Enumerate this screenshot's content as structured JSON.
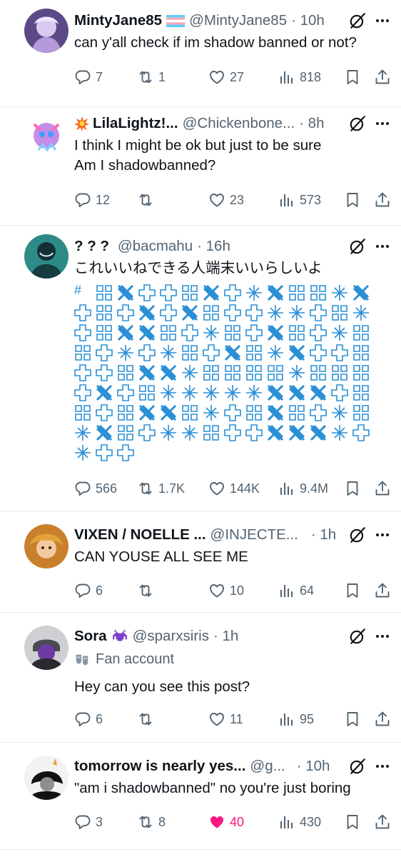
{
  "colors": {
    "text": "#0f1419",
    "muted": "#536471",
    "like": "#f91880",
    "divider": "#e6e9eb",
    "art": "#2a8fd6"
  },
  "posts": [
    {
      "name": "MintyJane85",
      "handle": "@MintyJane85",
      "time": "· 10h",
      "text": "can y'all check if im shadow banned or not?",
      "replies": "7",
      "reposts": "1",
      "likes": "27",
      "views": "818",
      "badge": "trans-flag-icon",
      "liked": false
    },
    {
      "name": "LilaLightz!...",
      "handle": "@Chickenbone...",
      "time": "· 8h",
      "text": "I think I might be ok but just to be sure",
      "text2": "Am I shadowbanned?",
      "replies": "12",
      "reposts": "",
      "likes": "23",
      "views": "573",
      "badge": "explosion-emoji-icon",
      "liked": false
    },
    {
      "name": "? ? ?",
      "handle": "@bacmahu",
      "time": "· 16h",
      "text": "これいいねできる人端末いいらしいよ",
      "art_lead": "#",
      "replies": "566",
      "reposts": "1.7K",
      "likes": "144K",
      "views": "9.4M",
      "liked": false
    },
    {
      "name": "VIXEN / NOELLE ...",
      "handle": "@INJECTE...",
      "time": "· 1h",
      "text": "CAN YOUSE ALL SEE ME",
      "replies": "6",
      "reposts": "",
      "likes": "10",
      "views": "64",
      "liked": false
    },
    {
      "name": "Sora",
      "handle": "@sparxsiris",
      "time": "· 1h",
      "label": "Fan account",
      "text": "Hey can you see this post?",
      "replies": "6",
      "reposts": "",
      "likes": "11",
      "views": "95",
      "badge": "space-invader-icon",
      "liked": false
    },
    {
      "name": "tomorrow is nearly yes...",
      "handle": "@g...",
      "time": "· 10h",
      "text": "\"am i shadowbanned\" no you're just boring",
      "replies": "3",
      "reposts": "8",
      "likes": "40",
      "views": "430",
      "liked": true
    }
  ]
}
